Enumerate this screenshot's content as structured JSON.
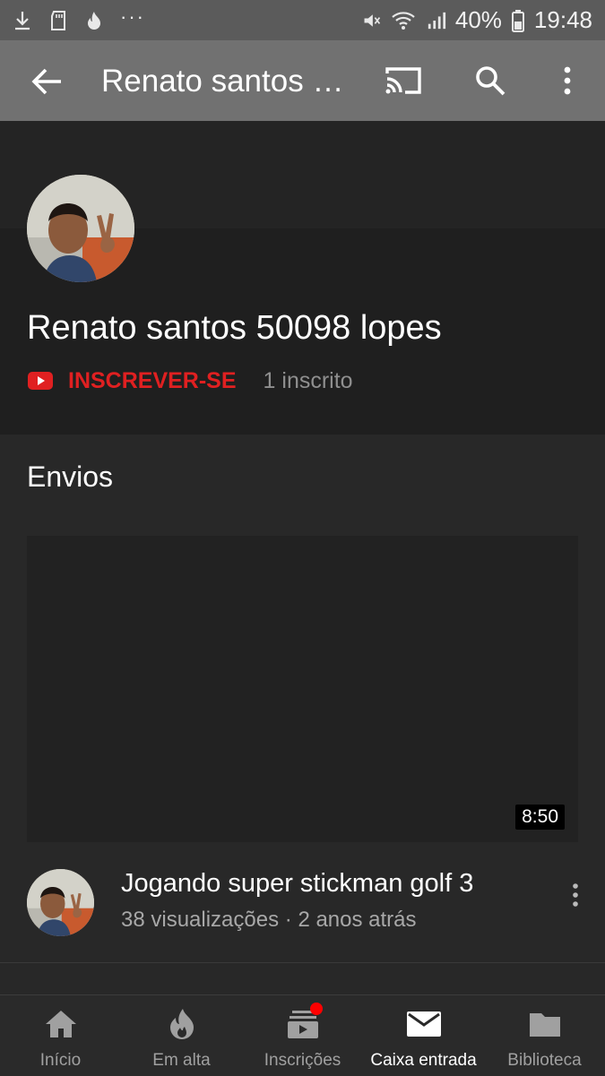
{
  "status_bar": {
    "battery": "40%",
    "time": "19:48",
    "dots": "···",
    "icons": [
      "download-icon",
      "sd-card-icon",
      "flame-icon",
      "mute-icon",
      "wifi-icon",
      "signal-icon",
      "battery-icon"
    ]
  },
  "app_bar": {
    "title": "Renato santos 50098 lopes",
    "icons": [
      "back-arrow-icon",
      "cast-icon",
      "search-icon",
      "more-vert-icon"
    ]
  },
  "channel": {
    "name": "Renato santos 50098 lopes",
    "subscribe_label": "INSCREVER-SE",
    "subscriber_count": "1 inscrito"
  },
  "uploads": {
    "section_title": "Envios",
    "video": {
      "duration": "8:50",
      "title": "Jogando super stickman golf 3",
      "views": "38 visualizações",
      "separator": " · ",
      "age": "2 anos atrás"
    }
  },
  "bottom_nav": {
    "items": [
      {
        "label": "Início",
        "icon": "home-icon"
      },
      {
        "label": "Em alta",
        "icon": "trending-icon"
      },
      {
        "label": "Inscrições",
        "icon": "subscriptions-icon"
      },
      {
        "label": "Caixa entrada",
        "icon": "inbox-icon"
      },
      {
        "label": "Biblioteca",
        "icon": "library-icon"
      }
    ],
    "active": "Caixa entrada"
  },
  "colors": {
    "accent_red": "#e02021",
    "app_bar": "#717171",
    "status_bar": "#5b5b5b",
    "background": "#282828"
  }
}
